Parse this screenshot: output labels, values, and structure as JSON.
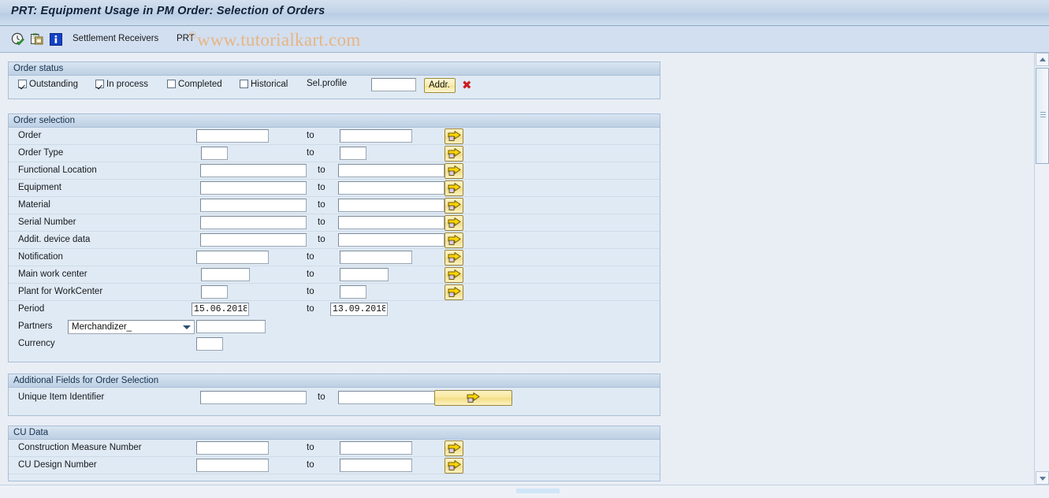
{
  "window": {
    "title": "PRT: Equipment Usage in PM Order: Selection of Orders"
  },
  "toolbar": {
    "icons": [
      {
        "name": "execute-clock-icon",
        "glyph": "clock-check"
      },
      {
        "name": "copy-icon",
        "glyph": "copy"
      },
      {
        "name": "info-icon",
        "glyph": "info"
      }
    ],
    "settlement_receivers_label": "Settlement Receivers",
    "prt_label": "PRT",
    "watermark_copyright": "©",
    "watermark_text": "www.tutorialkart.com"
  },
  "order_status": {
    "title": "Order status",
    "checkboxes": [
      {
        "label": "Outstanding",
        "checked": true
      },
      {
        "label": "In process",
        "checked": true
      },
      {
        "label": "Completed",
        "checked": false
      },
      {
        "label": "Historical",
        "checked": false
      }
    ],
    "sel_profile_label": "Sel.profile",
    "sel_profile_value": "",
    "addr_button_label": "Addr.",
    "delete_icon": "✖"
  },
  "order_selection": {
    "title": "Order selection",
    "to_label": "to",
    "rows": [
      {
        "label": "Order",
        "from": "",
        "to": "",
        "width": "md",
        "arrow": true
      },
      {
        "label": "Order Type",
        "from": "",
        "to": "",
        "width": "xs",
        "arrow": true
      },
      {
        "label": "Functional Location",
        "from": "",
        "to": "",
        "width": "lg",
        "arrow": true
      },
      {
        "label": "Equipment",
        "from": "",
        "to": "",
        "width": "lg",
        "arrow": true
      },
      {
        "label": "Material",
        "from": "",
        "to": "",
        "width": "lg",
        "arrow": true
      },
      {
        "label": "Serial Number",
        "from": "",
        "to": "",
        "width": "lg",
        "arrow": true
      },
      {
        "label": "Addit. device data",
        "from": "",
        "to": "",
        "width": "lg",
        "arrow": true
      },
      {
        "label": "Notification",
        "from": "",
        "to": "",
        "width": "md",
        "arrow": true
      },
      {
        "label": "Main work center",
        "from": "",
        "to": "",
        "width": "sm",
        "arrow": true
      },
      {
        "label": "Plant for WorkCenter",
        "from": "",
        "to": "",
        "width": "xs",
        "arrow": true
      }
    ],
    "period": {
      "label": "Period",
      "from": "15.06.2018",
      "to_label": "to",
      "to": "13.09.2018"
    },
    "partners": {
      "label": "Partners",
      "selected": "Merchandizer_",
      "value": ""
    },
    "currency": {
      "label": "Currency",
      "value": ""
    }
  },
  "additional_fields": {
    "title": "Additional Fields for Order Selection",
    "to_label": "to",
    "rows": [
      {
        "label": "Unique Item Identifier",
        "from": "",
        "to": "",
        "width": "lg",
        "wide_arrow": true
      }
    ]
  },
  "cu_data": {
    "title": "CU Data",
    "to_label": "to",
    "rows": [
      {
        "label": "Construction Measure Number",
        "from": "",
        "to": "",
        "width": "md",
        "arrow": true
      },
      {
        "label": "CU Design Number",
        "from": "",
        "to": "",
        "width": "md",
        "arrow": true
      }
    ]
  },
  "scrollbars": {
    "vertical": {
      "up": "▲",
      "down": "▼"
    },
    "horizontal": {}
  },
  "colors": {
    "titlebar": "#c4d5e8",
    "panel_bg": "#e0eaf4",
    "panel_header": "#c9d9ea",
    "page_bg": "#e9eef5",
    "button_yellow": "#f7e79c",
    "watermark": "#e8b583",
    "delete_red": "#cc1f1f"
  }
}
